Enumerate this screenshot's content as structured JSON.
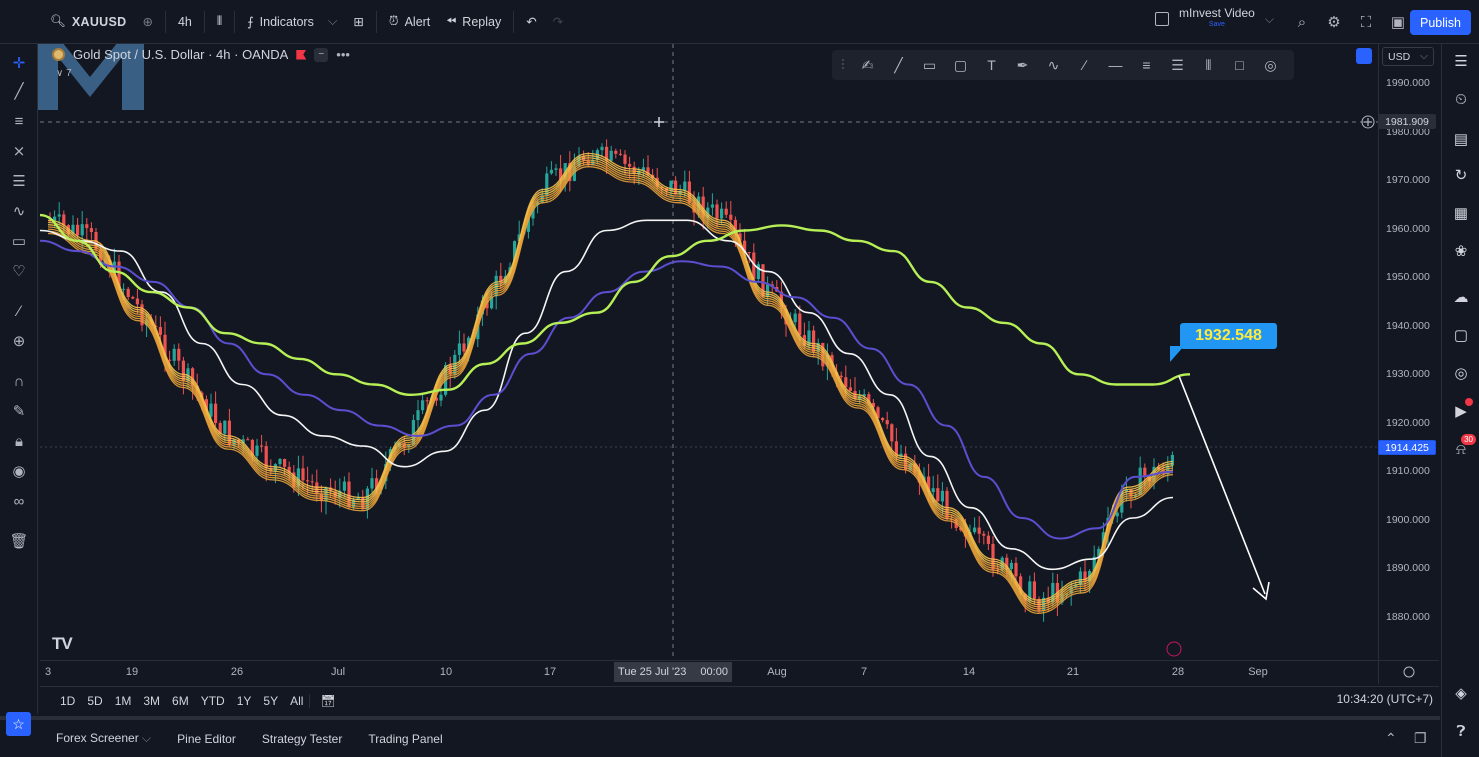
{
  "topbar": {
    "symbol": "XAUUSD",
    "interval": "4h",
    "indicators": "Indicators",
    "alert": "Alert",
    "replay": "Replay",
    "layout_name": "mInvest Video",
    "layout_sub": "Save",
    "publish": "Publish"
  },
  "legend": {
    "title": "Gold Spot / U.S. Dollar · 4h · OANDA",
    "sub": "7"
  },
  "currency": "USD",
  "price_axis": {
    "labels": [
      "1990.000",
      "1980.000",
      "1970.000",
      "1960.000",
      "1950.000",
      "1940.000",
      "1930.000",
      "1920.000",
      "1910.000",
      "1900.000",
      "1890.000",
      "1880.000"
    ],
    "crosshair_price": "1981.909",
    "last_price": "1914.425"
  },
  "time_axis": {
    "labels": [
      "3",
      "19",
      "26",
      "Jul",
      "10",
      "17",
      "Aug",
      "7",
      "14",
      "21",
      "28",
      "Sep"
    ],
    "crosshair_date": "Tue 25 Jul '23",
    "crosshair_time": "00:00"
  },
  "annotation": {
    "price": "1932.548"
  },
  "ranges": [
    "1D",
    "5D",
    "1M",
    "3M",
    "6M",
    "YTD",
    "1Y",
    "5Y",
    "All"
  ],
  "clock": "10:34:20 (UTC+7)",
  "bottom_tabs": [
    "Forex Screener",
    "Pine Editor",
    "Strategy Tester",
    "Trading Panel"
  ],
  "badges": {
    "alerts": "30"
  },
  "colors": {
    "background": "#131722",
    "up": "#26a69a",
    "down": "#ef5350",
    "ema200": "#b6f056",
    "ema100": "#5b4fd0",
    "ema50": "#f5f5f5",
    "ribbon": "#f5c04a",
    "accent": "#2962ff",
    "callout": "#2196f3"
  },
  "chart_data": {
    "type": "candlestick",
    "symbol": "Gold Spot / U.S. Dollar",
    "timeframe": "4h",
    "ylim": [
      1874,
      1994
    ],
    "series": [
      {
        "values": [
          1963,
          1958,
          1952,
          1948,
          1945,
          1940,
          1938,
          1935,
          1932,
          1930,
          1928,
          1929,
          1934,
          1938,
          1942,
          1944,
          1950,
          1955,
          1958,
          1960,
          1961,
          1960,
          1958,
          1956,
          1950,
          1945,
          1942,
          1938,
          1932,
          1930,
          1930,
          1932
        ]
      },
      {
        "values": [
          1958,
          1956,
          1953,
          1950,
          1945,
          1938,
          1932,
          1928,
          1925,
          1922,
          1920,
          1922,
          1928,
          1936,
          1943,
          1948,
          1952,
          1954,
          1953,
          1950,
          1947,
          1943,
          1937,
          1930,
          1922,
          1912,
          1904,
          1900,
          1902,
          1912,
          1913
        ]
      },
      {
        "values": [
          1960,
          1958,
          1956,
          1948,
          1938,
          1930,
          1924,
          1920,
          1918,
          1914,
          1917,
          1925,
          1940,
          1952,
          1960,
          1962,
          1962,
          1958,
          1952,
          1944,
          1936,
          1928,
          1916,
          1906,
          1898,
          1894,
          1896,
          1904,
          1908
        ]
      },
      {
        "values": [
          1962,
          1958,
          1945,
          1932,
          1920,
          1914,
          1910,
          1908,
          1920,
          1934,
          1950,
          1968,
          1975,
          1972,
          1968,
          1962,
          1948,
          1938,
          1928,
          1916,
          1906,
          1896,
          1888,
          1892,
          1910,
          1915
        ]
      }
    ]
  }
}
